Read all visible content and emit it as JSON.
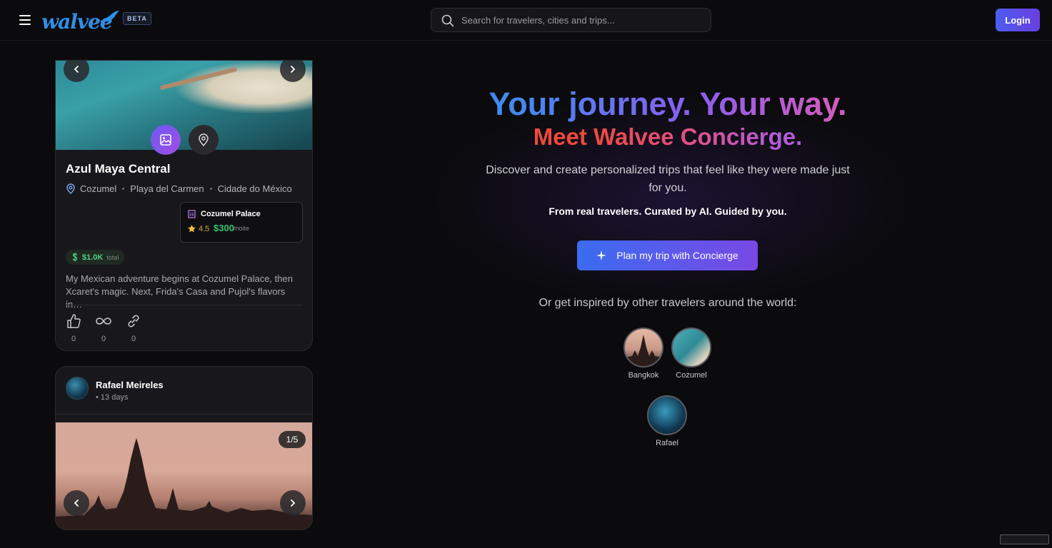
{
  "header": {
    "logo_text": "walvee",
    "beta_label": "BETA",
    "search_placeholder": "Search for travelers, cities and trips...",
    "login_label": "Login"
  },
  "trip_card": {
    "title": "Azul Maya Central",
    "places": [
      "Cozumel",
      "Playa del Carmen",
      "Cidade do México"
    ],
    "hotel": {
      "name": "Cozumel Palace",
      "rating": "4.5",
      "price": "$300",
      "price_unit": "/noite"
    },
    "cost": {
      "value": "$1.0K",
      "unit": "total"
    },
    "description": "My Mexican adventure begins at Cozumel Palace, then Xcaret's magic. Next, Frida's Casa and Pujol's flavors in…",
    "actions": {
      "likes": "0",
      "loops": "0",
      "links": "0"
    }
  },
  "post_card": {
    "user_name": "Rafael Meireles",
    "duration": "• 13 days",
    "photo_counter": "1/5"
  },
  "hero": {
    "headline": "Your journey. Your way.",
    "subheadline": "Meet Walvee Concierge.",
    "description": "Discover and create personalized trips that feel like they were made just for you.",
    "tagline": "From real travelers. Curated by AI. Guided by you.",
    "cta_label": "Plan my trip with Concierge",
    "inspired_text": "Or get inspired by other travelers around the world:",
    "bubbles": [
      {
        "label": "Bangkok"
      },
      {
        "label": "Cozumel"
      },
      {
        "label": "Rafael"
      }
    ]
  },
  "colors": {
    "accent": "#6a3fe0",
    "price_green": "#36c172",
    "rating_gold": "#d9a93a"
  }
}
